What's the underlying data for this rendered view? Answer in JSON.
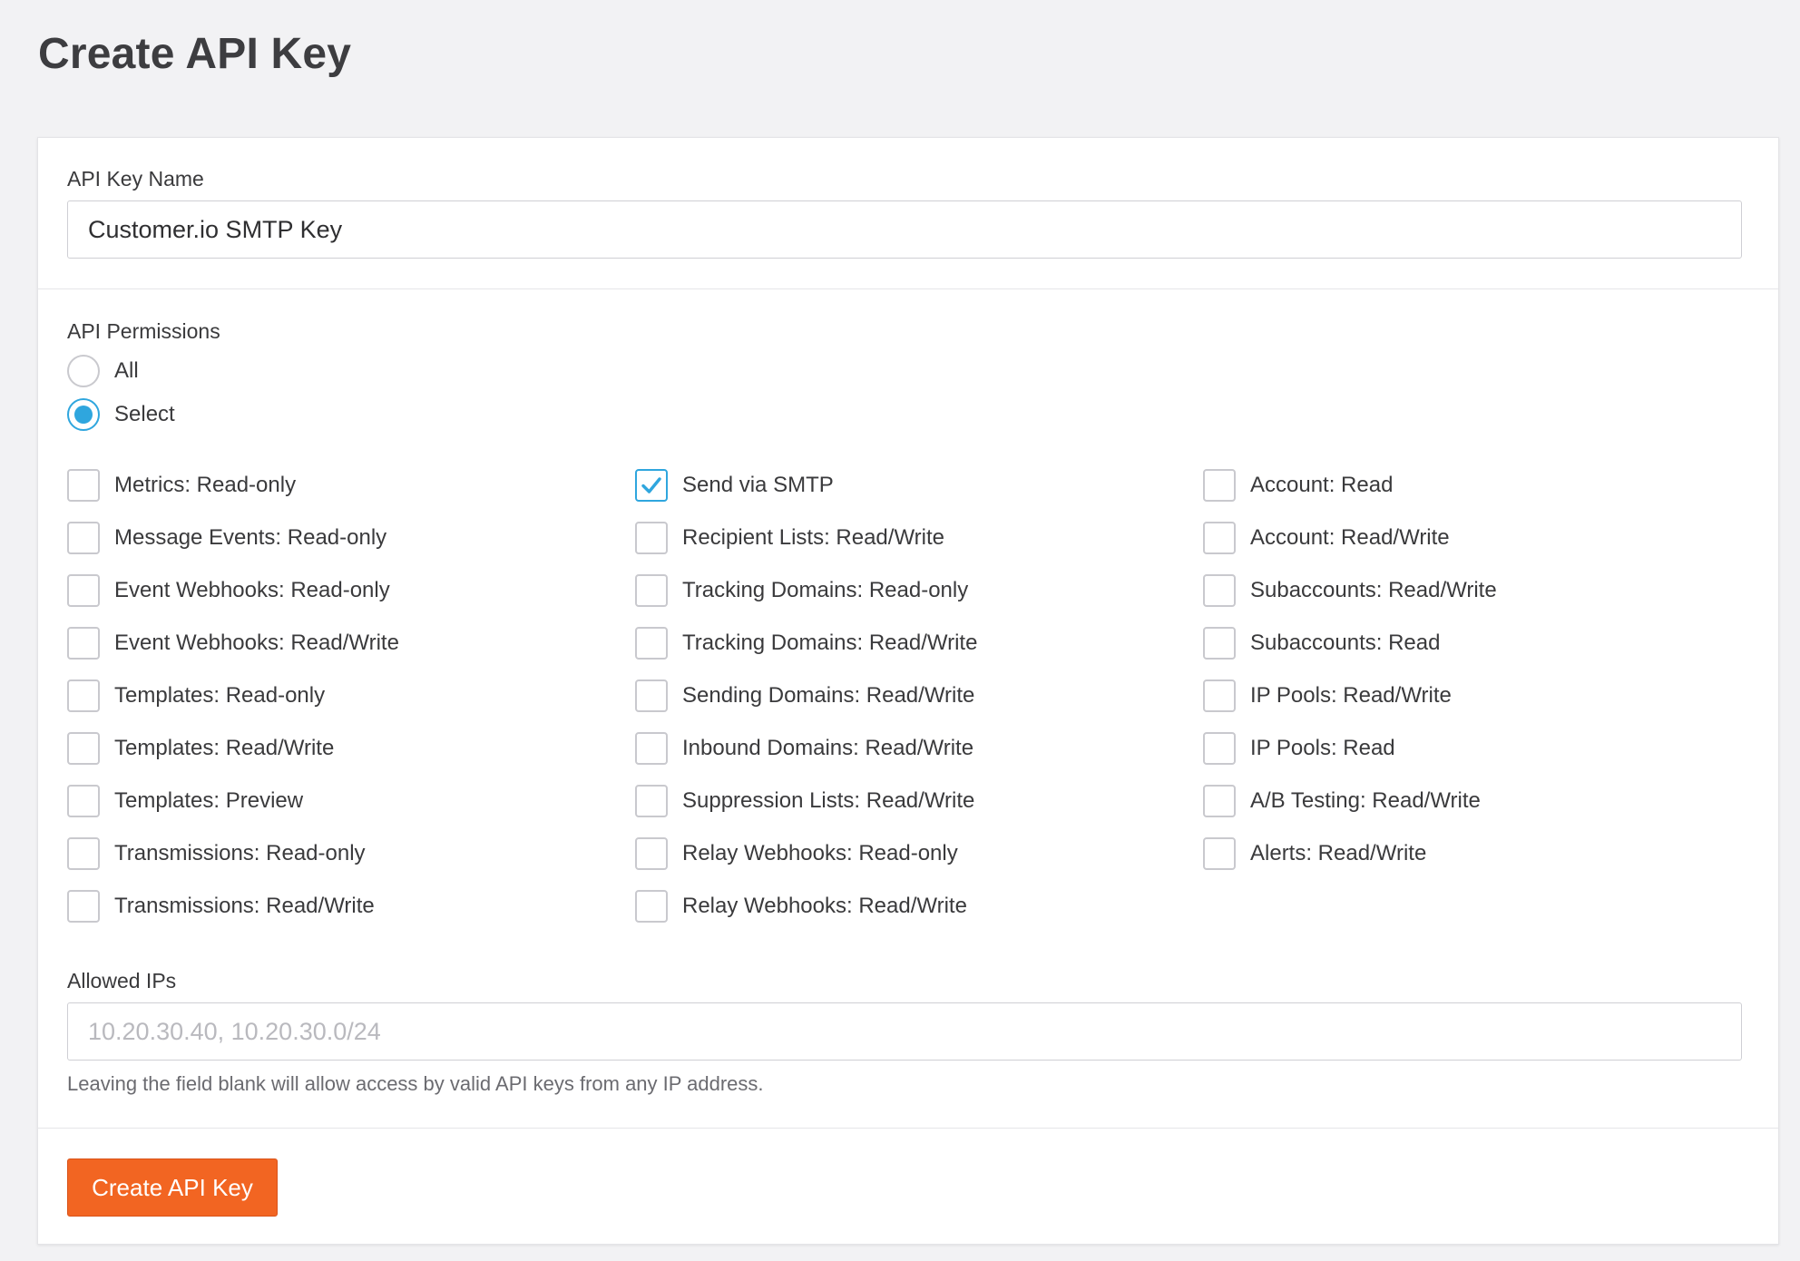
{
  "page": {
    "title": "Create API Key"
  },
  "name_field": {
    "label": "API Key Name",
    "value": "Customer.io SMTP Key"
  },
  "permissions": {
    "label": "API Permissions",
    "mode_options": [
      {
        "label": "All",
        "selected": false
      },
      {
        "label": "Select",
        "selected": true
      }
    ],
    "columns": [
      [
        {
          "label": "Metrics: Read-only",
          "checked": false
        },
        {
          "label": "Message Events: Read-only",
          "checked": false
        },
        {
          "label": "Event Webhooks: Read-only",
          "checked": false
        },
        {
          "label": "Event Webhooks: Read/Write",
          "checked": false
        },
        {
          "label": "Templates: Read-only",
          "checked": false
        },
        {
          "label": "Templates: Read/Write",
          "checked": false
        },
        {
          "label": "Templates: Preview",
          "checked": false
        },
        {
          "label": "Transmissions: Read-only",
          "checked": false
        },
        {
          "label": "Transmissions: Read/Write",
          "checked": false
        }
      ],
      [
        {
          "label": "Send via SMTP",
          "checked": true
        },
        {
          "label": "Recipient Lists: Read/Write",
          "checked": false
        },
        {
          "label": "Tracking Domains: Read-only",
          "checked": false
        },
        {
          "label": "Tracking Domains: Read/Write",
          "checked": false
        },
        {
          "label": "Sending Domains: Read/Write",
          "checked": false
        },
        {
          "label": "Inbound Domains: Read/Write",
          "checked": false
        },
        {
          "label": "Suppression Lists: Read/Write",
          "checked": false
        },
        {
          "label": "Relay Webhooks: Read-only",
          "checked": false
        },
        {
          "label": "Relay Webhooks: Read/Write",
          "checked": false
        }
      ],
      [
        {
          "label": "Account: Read",
          "checked": false
        },
        {
          "label": "Account: Read/Write",
          "checked": false
        },
        {
          "label": "Subaccounts: Read/Write",
          "checked": false
        },
        {
          "label": "Subaccounts: Read",
          "checked": false
        },
        {
          "label": "IP Pools: Read/Write",
          "checked": false
        },
        {
          "label": "IP Pools: Read",
          "checked": false
        },
        {
          "label": "A/B Testing: Read/Write",
          "checked": false
        },
        {
          "label": "Alerts: Read/Write",
          "checked": false
        }
      ]
    ]
  },
  "allowed_ips": {
    "label": "Allowed IPs",
    "value": "",
    "placeholder": "10.20.30.40, 10.20.30.0/24",
    "help": "Leaving the field blank will allow access by valid API keys from any IP address."
  },
  "submit": {
    "label": "Create API Key"
  },
  "colors": {
    "accent": "#2fa6de",
    "primary_button": "#f26522"
  }
}
